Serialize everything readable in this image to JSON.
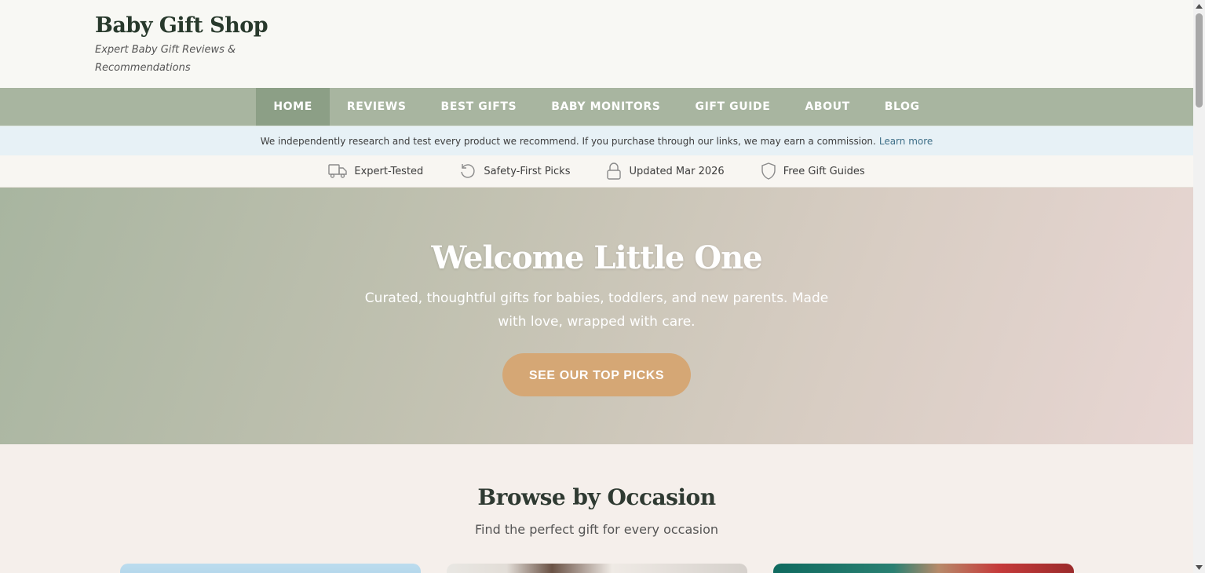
{
  "header": {
    "title": "Baby Gift Shop",
    "tagline": "Expert Baby Gift Reviews & Recommendations"
  },
  "nav": {
    "items": [
      {
        "label": "HOME",
        "active": true
      },
      {
        "label": "REVIEWS"
      },
      {
        "label": "BEST GIFTS"
      },
      {
        "label": "BABY MONITORS"
      },
      {
        "label": "GIFT GUIDE"
      },
      {
        "label": "ABOUT"
      },
      {
        "label": "BLOG"
      }
    ]
  },
  "disclosure": {
    "text": "We independently research and test every product we recommend. If you purchase through our links, we may earn a commission.",
    "link_label": "Learn more"
  },
  "trust_bar": {
    "items": [
      {
        "icon": "truck-icon",
        "label": "Expert-Tested"
      },
      {
        "icon": "refresh-icon",
        "label": "Safety-First Picks"
      },
      {
        "icon": "lock-icon",
        "label": "Updated Mar 2026"
      },
      {
        "icon": "shield-icon",
        "label": "Free Gift Guides"
      }
    ]
  },
  "hero": {
    "title": "Welcome Little One",
    "subtitle": "Curated, thoughtful gifts for babies, toddlers, and new parents. Made with love, wrapped with care.",
    "cta_label": "SEE OUR TOP PICKS"
  },
  "occasions": {
    "title": "Browse by Occasion",
    "subtitle": "Find the perfect gift for every occasion"
  },
  "colors": {
    "nav_bg": "#a8b5a0",
    "nav_active_bg": "#8c9f86",
    "cta_bg": "#d5a775",
    "disclosure_bg": "#e7f1f6",
    "link": "#3f6f88"
  }
}
